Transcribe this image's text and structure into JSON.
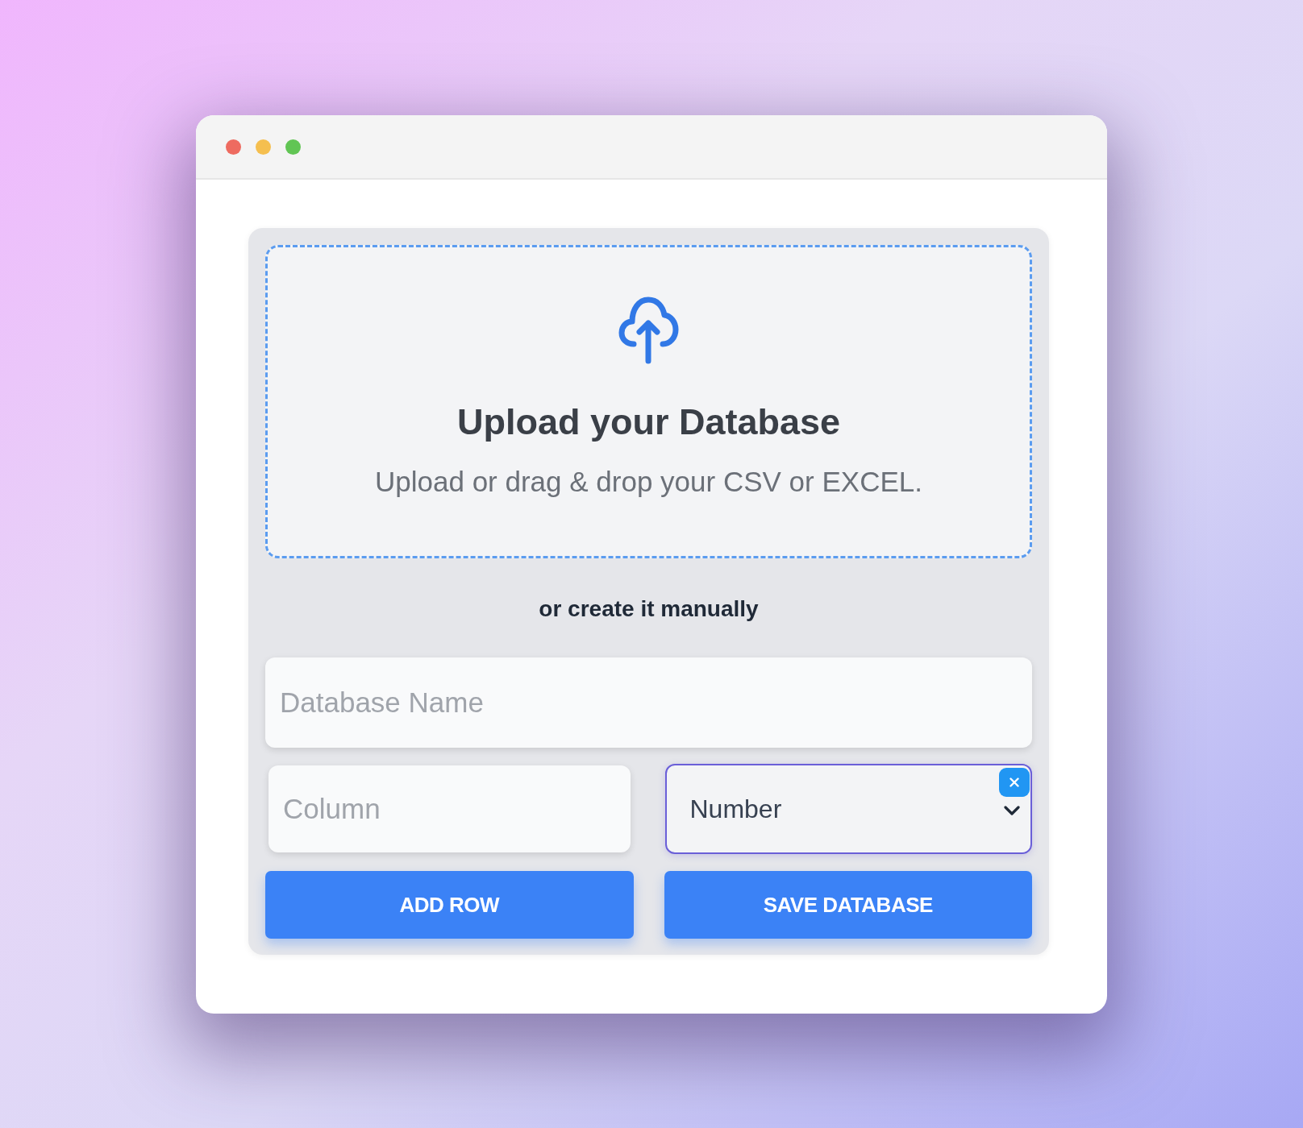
{
  "window": {
    "controls": [
      {
        "color": "#ee6b60"
      },
      {
        "color": "#f5bf4f"
      },
      {
        "color": "#61c554"
      }
    ]
  },
  "dropzone": {
    "title": "Upload your Database",
    "subtitle": "Upload or drag & drop your CSV or EXCEL."
  },
  "divider_text": "or create it manually",
  "form": {
    "database_name": {
      "placeholder": "Database Name"
    },
    "column": {
      "placeholder": "Column"
    },
    "type_select": {
      "value": "Number",
      "focused": true
    },
    "buttons": [
      {
        "label": "ADD ROW"
      },
      {
        "label": "SAVE DATABASE"
      }
    ]
  }
}
